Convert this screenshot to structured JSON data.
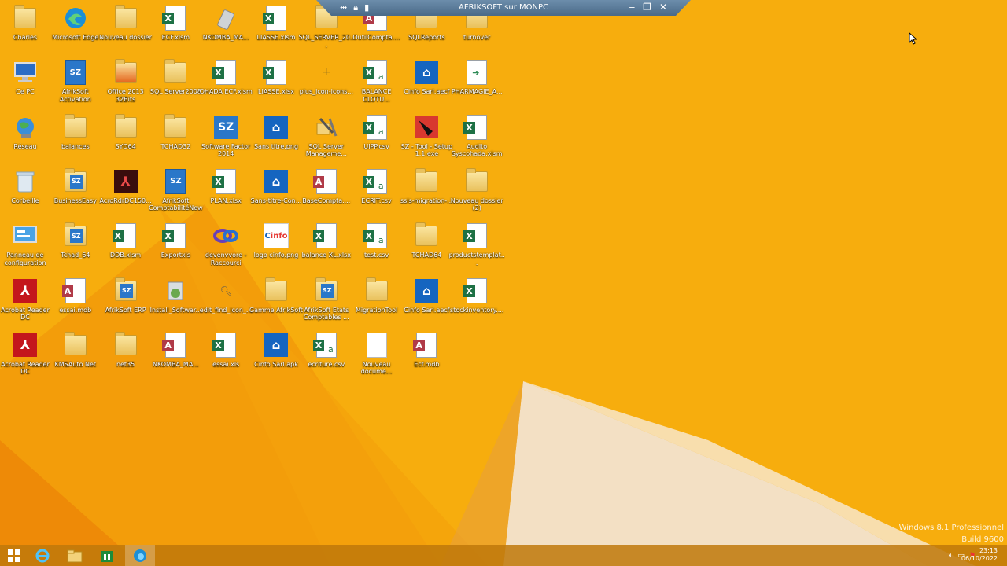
{
  "remote_bar": {
    "title": "AFRIKSOFT sur MONPC"
  },
  "columns": [
    [
      {
        "label": "Charles",
        "type": "user-folder-icon"
      },
      {
        "label": "Ce PC",
        "type": "computer-icon"
      },
      {
        "label": "Réseau",
        "type": "network-icon"
      },
      {
        "label": "Corbeille",
        "type": "recycle-bin-icon"
      },
      {
        "label": "Panneau de configuration",
        "type": "control-panel-icon"
      },
      {
        "label": "Acrobat Reader DC",
        "type": "acrobat-icon"
      },
      {
        "label": "Acrobat Reader DC",
        "type": "acrobat-icon"
      }
    ],
    [
      {
        "label": "Microsoft Edge",
        "type": "edge-icon"
      },
      {
        "label": "AfrikSoft Activation",
        "type": "sz-file-icon"
      },
      {
        "label": "balances",
        "type": "folder-icon"
      },
      {
        "label": "BusinessEasy",
        "type": "sz-folder-icon"
      },
      {
        "label": "Tchad_64",
        "type": "sz-folder-icon"
      },
      {
        "label": "essai.mdb",
        "type": "access-icon"
      },
      {
        "label": "KMSAuto Net",
        "type": "folder-icon"
      }
    ],
    [
      {
        "label": "Nouveau dossier",
        "type": "folder-icon"
      },
      {
        "label": "Office 2013 32Bits",
        "type": "office-folder-icon"
      },
      {
        "label": "SYD64",
        "type": "folder-icon"
      },
      {
        "label": "AcroRdrDC150...",
        "type": "acrobat-installer-icon"
      },
      {
        "label": "DDB.xlsm",
        "type": "excel-icon"
      },
      {
        "label": "AfrikSoft ERP",
        "type": "sz-folder-icon"
      },
      {
        "label": "net35",
        "type": "folder-icon"
      }
    ],
    [
      {
        "label": "ECF.xlsm",
        "type": "excel-icon"
      },
      {
        "label": "SQL Server2008",
        "type": "folder-icon"
      },
      {
        "label": "TCHAD32",
        "type": "folder-icon"
      },
      {
        "label": "AfrikSoft ComptabilitéNew",
        "type": "sz-file-icon"
      },
      {
        "label": "Exportxls",
        "type": "excel-icon"
      },
      {
        "label": "Install_Softwar...",
        "type": "installer-icon"
      },
      {
        "label": "NKOMBA_MA...",
        "type": "access-icon"
      }
    ],
    [
      {
        "label": "NKOMBA_MA...",
        "type": "usb-drive-icon"
      },
      {
        "label": "OHADA ECF.xlsm",
        "type": "excel-icon"
      },
      {
        "label": "Software Factor 2014",
        "type": "sz-tile-icon"
      },
      {
        "label": "PLAN.xlsx",
        "type": "excel-icon"
      },
      {
        "label": "devenvvore - Raccourci",
        "type": "visual-studio-icon"
      },
      {
        "label": "edit_find_icon_...",
        "type": "search-file-icon"
      },
      {
        "label": "essai.xls",
        "type": "excel-icon"
      }
    ],
    [
      {
        "label": "LIASSE.xlsm",
        "type": "excel-icon"
      },
      {
        "label": "LIASSE.xlsx",
        "type": "excel-icon"
      },
      {
        "label": "Sans titre.png",
        "type": "cinfo-tile-icon"
      },
      {
        "label": "Sans-titre-Con...",
        "type": "cinfo-tile-icon"
      },
      {
        "label": "logo cinfo.png",
        "type": "cinfo-logo-icon"
      },
      {
        "label": "Gamme AfrikSoft",
        "type": "folder-icon"
      },
      {
        "label": "Cinfo Sarl.apk",
        "type": "cinfo-tile-icon"
      }
    ],
    [
      {
        "label": "SQL_SERVER_20...",
        "type": "folder-icon"
      },
      {
        "label": "plus_icon-icons...",
        "type": "plus-icon"
      },
      {
        "label": "SQL Server Manageme...",
        "type": "sql-tools-icon"
      },
      {
        "label": "BaseCompta....",
        "type": "access-icon"
      },
      {
        "label": "balance XL.xlsx",
        "type": "excel-icon"
      },
      {
        "label": "AfrikSoft Etats Comptables ...",
        "type": "sz-folder-icon"
      },
      {
        "label": "ecriture.csv",
        "type": "csv-icon"
      }
    ],
    [
      {
        "label": "OutilCompta....",
        "type": "access-icon"
      },
      {
        "label": "BALANCE CLOTU...",
        "type": "csv-icon"
      },
      {
        "label": "UIPP.csv",
        "type": "csv-icon"
      },
      {
        "label": "ECRIT.csv",
        "type": "csv-icon"
      },
      {
        "label": "test.csv",
        "type": "csv-icon"
      },
      {
        "label": "MigrationTool",
        "type": "folder-icon"
      },
      {
        "label": "Nouveau docume...",
        "type": "text-file-icon"
      }
    ],
    [
      {
        "label": "SQLReports",
        "type": "folder-icon"
      },
      {
        "label": "Cinfo Sarl.aecf",
        "type": "cinfo-tile-icon"
      },
      {
        "label": "SZ - Tool - Setup 1.1.exe",
        "type": "setup-icon"
      },
      {
        "label": "ssis-migration-...",
        "type": "folder-icon"
      },
      {
        "label": "TCHAD64",
        "type": "folder-icon"
      },
      {
        "label": "Cinfo Sarl.aecf",
        "type": "cinfo-tile-icon"
      },
      {
        "label": "Ecf.mdb",
        "type": "access-icon"
      }
    ],
    [
      {
        "label": "turnover",
        "type": "folder-icon"
      },
      {
        "label": "PHARMAGIE_A...",
        "type": "document-icon"
      },
      {
        "label": "Audito Syscohada.xlsm",
        "type": "excel-icon"
      },
      {
        "label": "Nouveau dossier (2)",
        "type": "folder-icon"
      },
      {
        "label": "productstemplat...",
        "type": "excel-icon"
      },
      {
        "label": "stockinventory....",
        "type": "excel-icon"
      }
    ]
  ],
  "taskbar": {
    "items": [
      {
        "name": "start-button-icon"
      },
      {
        "name": "internet-explorer-icon"
      },
      {
        "name": "file-explorer-icon"
      },
      {
        "name": "store-icon"
      },
      {
        "name": "remote-desktop-taskbar-icon"
      }
    ]
  },
  "clock": {
    "time": "23:13",
    "date": "06/10/2022"
  },
  "watermark": {
    "line1": "Windows 8.1 Professionnel",
    "line2": "Build 9600"
  },
  "colors": {
    "wallpaper_base": "#f7ae0c",
    "wallpaper_dark": "#f08a08",
    "excel": "#1e7145",
    "sz_blue": "#2a77c9",
    "cinfo_blue": "#1565c0",
    "acrobat": "#c4161c"
  }
}
